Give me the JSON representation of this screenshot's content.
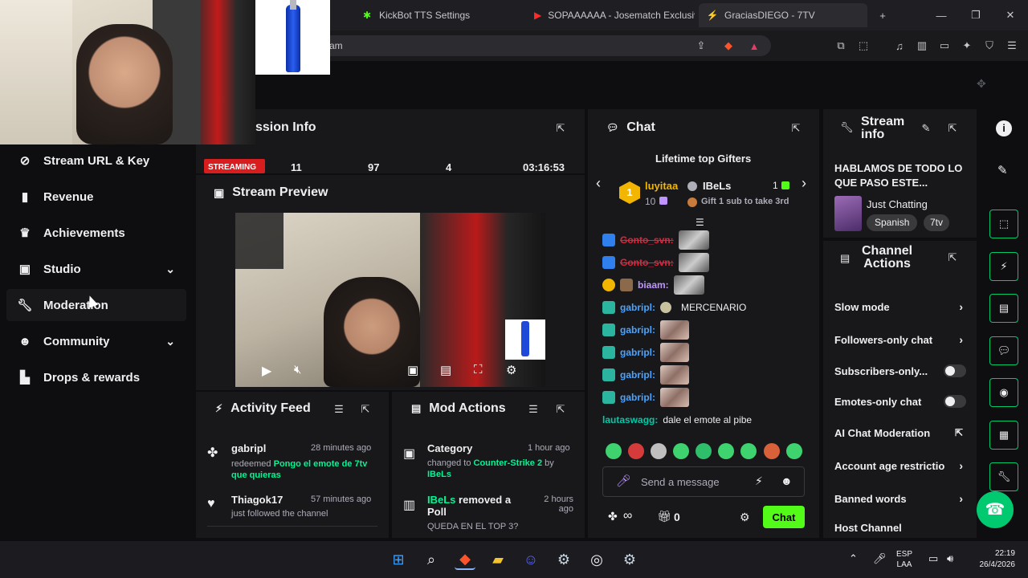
{
  "browser": {
    "tabs": [
      {
        "label": "KickBot TTS Settings"
      },
      {
        "label": "SOPAAAAAA - Josematch Exclusiv"
      },
      {
        "label": "GraciasDIEGO - 7TV"
      }
    ],
    "url_fragment": "am"
  },
  "sidebar": {
    "items": [
      {
        "label": "Stream URL & Key",
        "icon": "link-icon"
      },
      {
        "label": "Revenue",
        "icon": "chart-icon"
      },
      {
        "label": "Achievements",
        "icon": "trophy-icon"
      },
      {
        "label": "Studio",
        "icon": "studio-icon"
      },
      {
        "label": "Moderation",
        "icon": "wrench-icon"
      },
      {
        "label": "Community",
        "icon": "people-icon"
      },
      {
        "label": "Drops & rewards",
        "icon": "gift-icon"
      }
    ]
  },
  "session": {
    "title": "ssion Info",
    "status": "STREAMING",
    "stats": [
      "11",
      "97",
      "4",
      "03:16:53"
    ]
  },
  "preview": {
    "title": "Stream Preview"
  },
  "activity": {
    "title": "Activity Feed",
    "items": [
      {
        "user": "gabripl",
        "time": "28 minutes ago",
        "action": "redeemed",
        "reward": "Pongo el emote de 7tv que quieras"
      },
      {
        "user": "Thiagok17",
        "time": "57 minutes ago",
        "action": "just followed the channel"
      }
    ]
  },
  "modactions": {
    "title": "Mod Actions",
    "items": [
      {
        "heading": "Category",
        "time": "1 hour ago",
        "line1": "changed to",
        "target": "Counter-Strike 2",
        "by": "by",
        "user": "IBeLs"
      },
      {
        "user": "IBeLs",
        "heading": "removed a Poll",
        "time": "2 hours ago",
        "line1": "QUEDA EN EL TOP 3?"
      }
    ]
  },
  "chat": {
    "title": "Chat",
    "gifters_title": "Lifetime top Gifters",
    "gifter1": {
      "rank": "1",
      "name": "luyitaa",
      "count": "10"
    },
    "gifter2": {
      "name": "IBeLs",
      "count": "1"
    },
    "gifter3_text": "Gift 1 sub to take 3rd",
    "messages": [
      {
        "user": "Gonto_svn:",
        "text": ""
      },
      {
        "user": "Gonto_svn:",
        "text": ""
      },
      {
        "user": "biaam:",
        "text": ""
      },
      {
        "user": "gabripl:",
        "text": "MERCENARIO"
      },
      {
        "user": "gabripl:",
        "text": ""
      },
      {
        "user": "gabripl:",
        "text": ""
      },
      {
        "user": "gabripl:",
        "text": ""
      },
      {
        "user": "gabripl:",
        "text": ""
      },
      {
        "user": "lautaswagg:",
        "text": "dale el emote al pibe"
      }
    ],
    "placeholder": "Send a message",
    "infinity": "∞",
    "gift_count": "0",
    "send_label": "Chat"
  },
  "streaminfo": {
    "title_line1": "Stream",
    "title_line2": "info",
    "stream_title": "HABLAMOS DE TODO LO QUE PASO ESTE...",
    "category": "Just Chatting",
    "tags": [
      "Spanish",
      "7tv"
    ]
  },
  "channelactions": {
    "title_line1": "Channel",
    "title_line2": "Actions",
    "items": [
      {
        "label": "Slow mode"
      },
      {
        "label": "Followers-only chat"
      },
      {
        "label": "Subscribers-only..."
      },
      {
        "label": "Emotes-only chat"
      },
      {
        "label": "AI Chat Moderation"
      },
      {
        "label": "Account age restrictio"
      },
      {
        "label": "Banned words"
      },
      {
        "label": "Host Channel"
      }
    ]
  },
  "tray": {
    "lang1": "ESP",
    "lang2": "LAA",
    "time": "22:19",
    "date": "26/4/2026"
  },
  "colors": {
    "accent": "#53fc18",
    "panel": "#18181b",
    "bg": "#0e0e10"
  }
}
